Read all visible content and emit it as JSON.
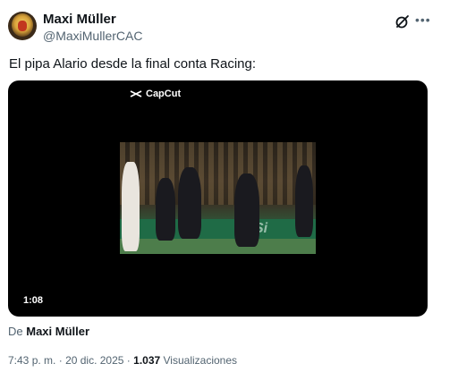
{
  "tweet": {
    "author_name": "Maxi Müller",
    "author_handle": "@MaxiMullerCAC",
    "text": "El pipa Alario desde la final conta Racing:",
    "video": {
      "watermark": "CapCut",
      "duration": "1:08",
      "board_text": "Si"
    },
    "byline_prefix": "De",
    "byline_name": "Maxi Müller",
    "time": "7:43 p. m.",
    "separator1": "·",
    "date": "20 dic. 2025",
    "separator2": "·",
    "views": "1.037",
    "views_label": "Visualizaciones"
  },
  "icons": {
    "grok": "grok-icon",
    "more": "more-icon",
    "capcut": "capcut-logo-icon"
  },
  "colors": {
    "text_primary": "#0f1419",
    "text_secondary": "#536471"
  }
}
